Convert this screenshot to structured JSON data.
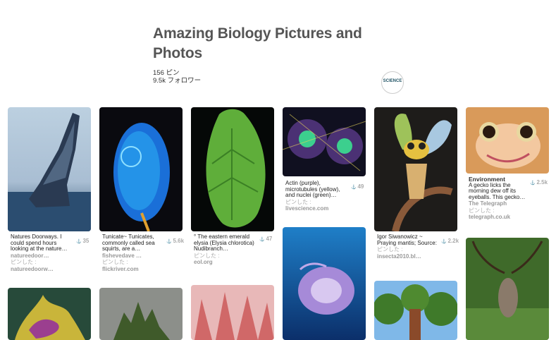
{
  "board": {
    "title": "Amazing Biology Pictures and Photos",
    "pins_count": "156 ピン",
    "followers_count": "9.5k フォロワー",
    "avatar_text": "SCIENCE"
  },
  "pins": [
    {
      "desc": "Natures Doorways. I could spend hours looking at the nature…",
      "src1": "natureedoor…",
      "pinned": "ピンした :",
      "src2": "natureedoorw…",
      "count": "35"
    },
    {
      "desc": "Tunicate~ Tunicates, commonly called sea squirts, are a…",
      "src1": "fishevedave …",
      "pinned": "ピンした :",
      "src2": "flickriver.com",
      "count": "5.6k"
    },
    {
      "desc": "° The eastern emerald elysia (Elysia chlorotica) Nudibranch…",
      "pinned": "ピンした :",
      "src2": "eol.org",
      "count": "47"
    },
    {
      "desc": "Actin (purple), microtubules (yellow), and nuclei (green)…",
      "pinned": "ピンした :",
      "src2": "livescience.com",
      "count": "49"
    },
    {
      "desc": "Igor Siwanowicz ~ Praying mantis; Source:",
      "pinned": "ピンした :",
      "src2": "insecta2010.bl…",
      "count": "2.2k"
    },
    {
      "title": "Environment",
      "desc": "A gecko licks the morning dew off its eyeballs. This gecko…",
      "src1": "The Telegraph",
      "pinned": "ピンした :",
      "src2": "telegraph.co.uk",
      "count": "2.5k"
    }
  ]
}
